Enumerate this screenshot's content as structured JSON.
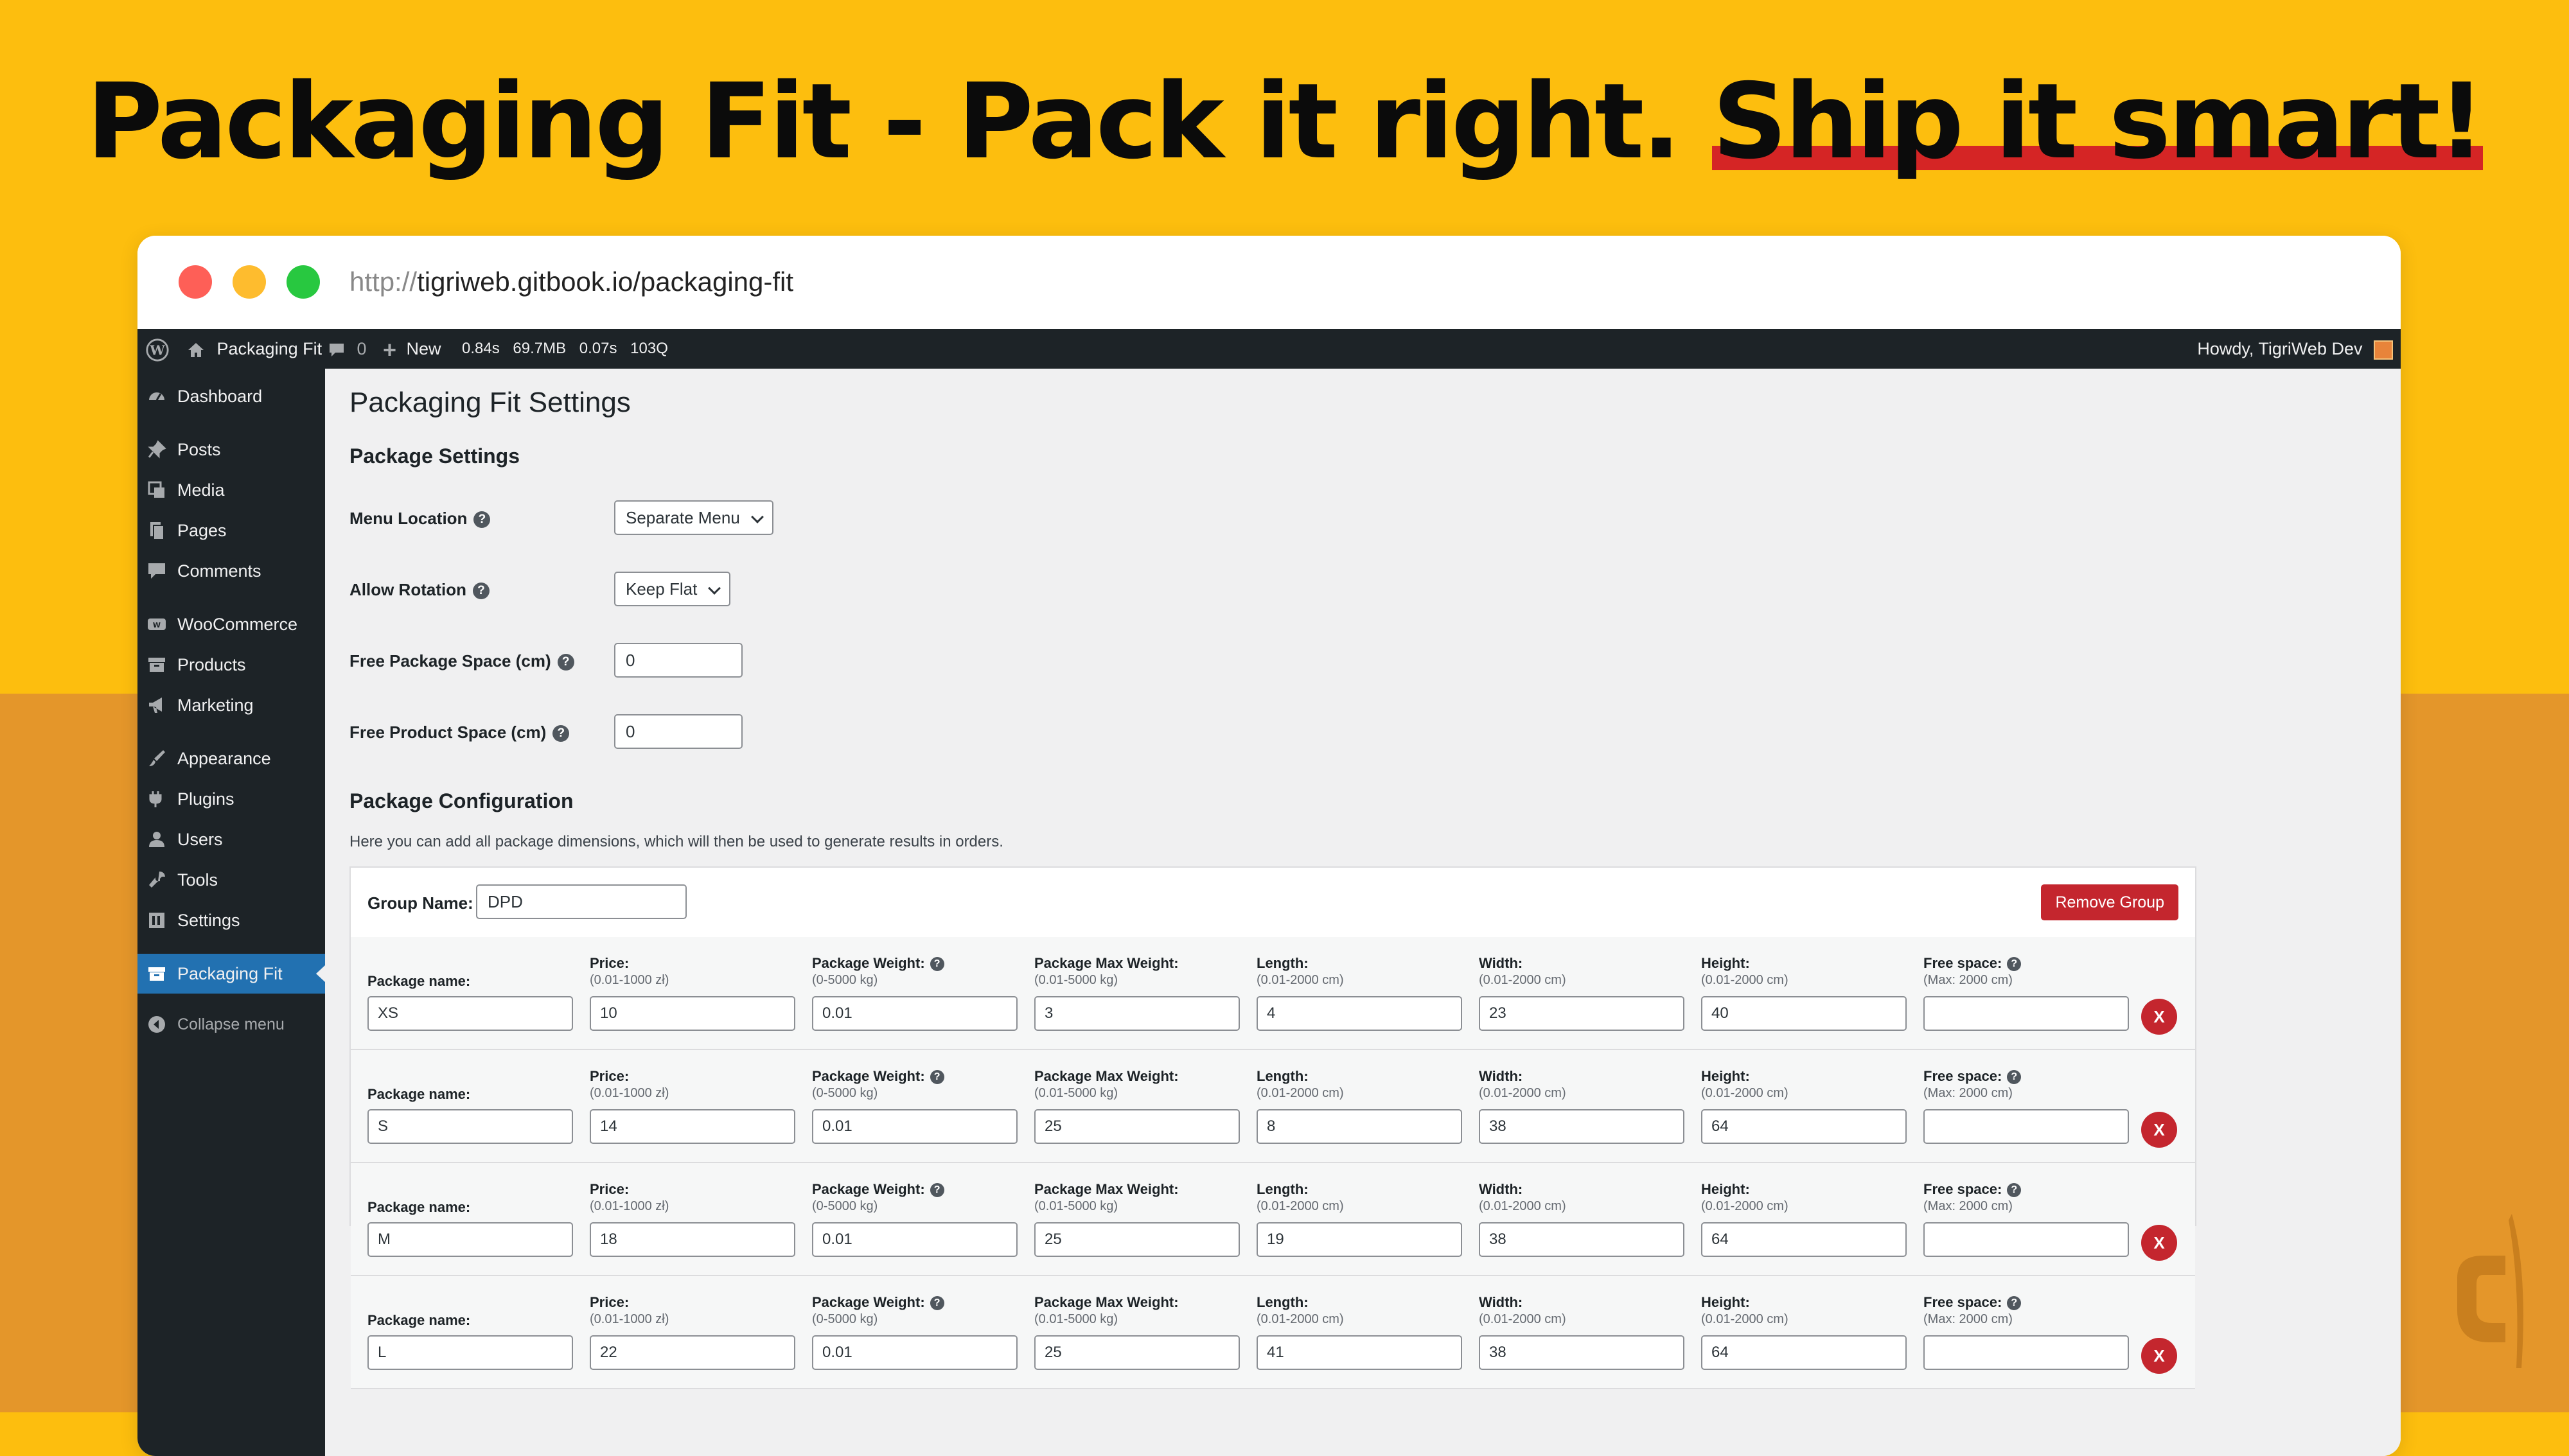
{
  "headline": {
    "part1": "Packaging Fit - Pack it right. ",
    "part2": "Ship it smart!"
  },
  "browser": {
    "url_protocol": "http://",
    "url_rest": "tigriweb.gitbook.io/packaging-fit"
  },
  "adminbar": {
    "site_name": "Packaging Fit",
    "comments_count": "0",
    "new_label": "New",
    "stats": [
      "0.84s",
      "69.7MB",
      "0.07s",
      "103Q"
    ],
    "greeting": "Howdy, TigriWeb Dev"
  },
  "sidebar": {
    "items": [
      {
        "label": "Dashboard",
        "icon": "dashboard-icon"
      },
      {
        "label": "Posts",
        "icon": "pin-icon"
      },
      {
        "label": "Media",
        "icon": "media-icon"
      },
      {
        "label": "Pages",
        "icon": "pages-icon"
      },
      {
        "label": "Comments",
        "icon": "comment-icon"
      },
      {
        "label": "WooCommerce",
        "icon": "woo-icon"
      },
      {
        "label": "Products",
        "icon": "archive-icon"
      },
      {
        "label": "Marketing",
        "icon": "megaphone-icon"
      },
      {
        "label": "Appearance",
        "icon": "brush-icon"
      },
      {
        "label": "Plugins",
        "icon": "plug-icon"
      },
      {
        "label": "Users",
        "icon": "user-icon"
      },
      {
        "label": "Tools",
        "icon": "wrench-icon"
      },
      {
        "label": "Settings",
        "icon": "settings-icon"
      },
      {
        "label": "Packaging Fit",
        "icon": "box-icon"
      },
      {
        "label": "Collapse menu",
        "icon": "collapse-icon"
      }
    ]
  },
  "page": {
    "title": "Packaging Fit Settings",
    "package_settings_heading": "Package Settings",
    "menu_location": {
      "label": "Menu Location",
      "value": "Separate Menu"
    },
    "allow_rotation": {
      "label": "Allow Rotation",
      "value": "Keep Flat"
    },
    "free_package_space": {
      "label": "Free Package Space (cm)",
      "value": "0"
    },
    "free_product_space": {
      "label": "Free Product Space (cm)",
      "value": "0"
    },
    "package_config_heading": "Package Configuration",
    "package_config_desc": "Here you can add all package dimensions, which will then be used to generate results in orders."
  },
  "group": {
    "name_label": "Group Name:",
    "name_value": "DPD",
    "remove_label": "Remove Group",
    "columns": {
      "name": {
        "label": "Package name:"
      },
      "price": {
        "label": "Price:",
        "range": "(0.01-1000 zł)"
      },
      "weight": {
        "label": "Package Weight:",
        "range": "(0-5000 kg)"
      },
      "max_weight": {
        "label": "Package Max Weight:",
        "range": "(0.01-5000 kg)"
      },
      "length": {
        "label": "Length:",
        "range": "(0.01-2000 cm)"
      },
      "width": {
        "label": "Width:",
        "range": "(0.01-2000 cm)"
      },
      "height": {
        "label": "Height:",
        "range": "(0.01-2000 cm)"
      },
      "free_space": {
        "label": "Free space:",
        "range": "(Max: 2000 cm)"
      }
    },
    "delete_label": "X",
    "packages": [
      {
        "name": "XS",
        "price": "10",
        "weight": "0.01",
        "max_weight": "3",
        "length": "4",
        "width": "23",
        "height": "40",
        "free_space": ""
      },
      {
        "name": "S",
        "price": "14",
        "weight": "0.01",
        "max_weight": "25",
        "length": "8",
        "width": "38",
        "height": "64",
        "free_space": ""
      },
      {
        "name": "M",
        "price": "18",
        "weight": "0.01",
        "max_weight": "25",
        "length": "19",
        "width": "38",
        "height": "64",
        "free_space": ""
      },
      {
        "name": "L",
        "price": "22",
        "weight": "0.01",
        "max_weight": "25",
        "length": "41",
        "width": "38",
        "height": "64",
        "free_space": ""
      }
    ]
  },
  "colors": {
    "background_top": "#fdbe0e",
    "background_bottom": "#e4962a",
    "headline_underline": "#d52525",
    "admin_dark": "#1d2327",
    "active_menu": "#2271b1",
    "danger": "#c4262e"
  }
}
